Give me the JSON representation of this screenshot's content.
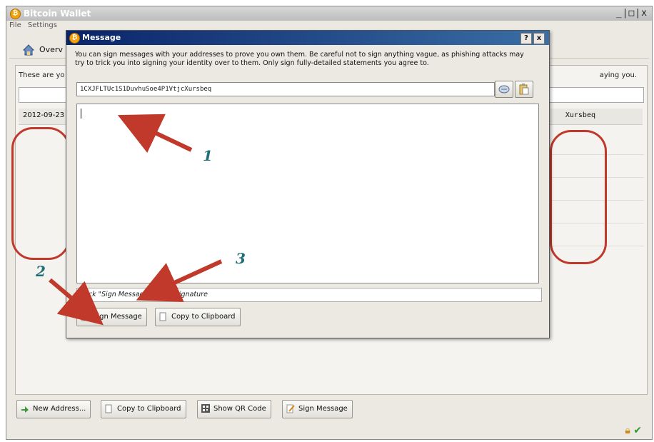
{
  "main_window": {
    "title": "Bitcoin Wallet",
    "controls": "_|□|x",
    "menu": [
      "File",
      "Settings"
    ],
    "toolbar": {
      "overview_label": "Overv"
    },
    "address_book": {
      "desc_left": "These are yo",
      "desc_right": "aying you.",
      "row_date": "2012-09-23",
      "row_address_tail": "Xursbeq"
    },
    "buttons": {
      "new_address": "New Address...",
      "copy_to_clipboard": "Copy to Clipboard",
      "show_qr_code": "Show QR Code",
      "sign_message": "Sign Message"
    }
  },
  "dialog": {
    "title": "Message",
    "help_btn": "?",
    "close_btn": "x",
    "description": "You can sign messages with your addresses to prove you own them. Be careful not to sign anything vague, as phishing attacks may try to trick you into signing your identity over to them. Only sign fully-detailed statements you agree to.",
    "address_value": "1CXJFLTUc1S1DuvhuSoe4P1VtjcXursbeq",
    "message_value": "",
    "signature_placeholder": "Click \"Sign Message\" to get signature",
    "sign_button": "Sign Message",
    "copy_button": "Copy to Clipboard"
  },
  "annotations": {
    "n1": "1",
    "n2": "2",
    "n3": "3"
  },
  "colors": {
    "annotation_red": "#c0392b",
    "annotation_number": "#1f6e78",
    "dialog_title_blue": "#0a246a"
  },
  "icons": [
    "bitcoin-icon",
    "home-icon",
    "address-book-icon",
    "paste-icon",
    "add-icon",
    "copy-icon",
    "qr-icon",
    "sign-icon",
    "lock-icon",
    "check-icon"
  ]
}
